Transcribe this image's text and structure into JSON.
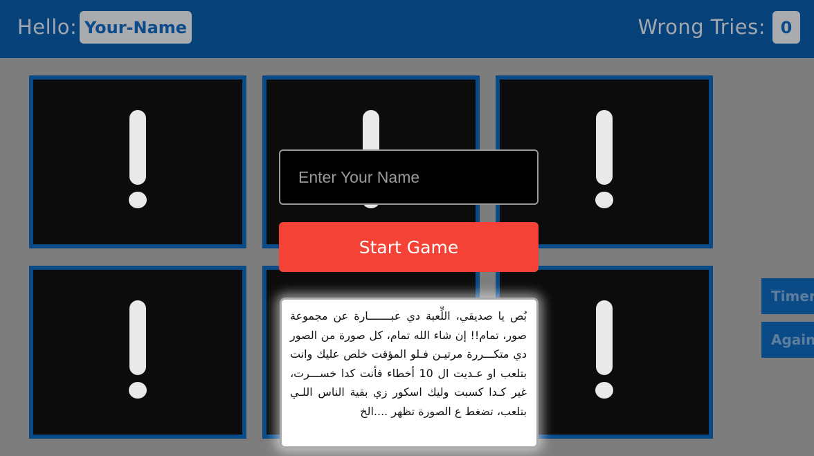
{
  "header": {
    "hello_label": "Hello:",
    "player_name": "Your-Name",
    "wrong_tries_label": "Wrong Tries:",
    "wrong_tries_count": "0",
    "background_color": "#08427a"
  },
  "cards": [
    {
      "face": "!",
      "state": "hidden"
    },
    {
      "face": "!",
      "state": "hidden"
    },
    {
      "face": "!",
      "state": "hidden"
    },
    {
      "face": "!",
      "state": "hidden"
    },
    {
      "face": "!",
      "state": "hidden"
    },
    {
      "face": "!",
      "state": "hidden"
    }
  ],
  "side_buttons": {
    "timer_label": "Timer",
    "again_label": "Again"
  },
  "start_overlay": {
    "name_placeholder": "Enter Your Name",
    "name_value": "",
    "start_button_label": "Start Game",
    "start_button_color": "#f44336",
    "rules_text": "بُص يا صديقي، اللِّعبة دي عبـــــــارة عن مجموعة صور، تمام!! إن شاء الله تمام، كل صورة من الصور دي متكـــررة مرتيـن فـلو المؤقت خلص عليك وانت بتلعب او عـديت ال 10 أخطاء فأنت كدا خســـرت، غير كـدا كسبت وليك اسكور زي بقية الناس اللـي بتلعب، تضغط ع الصورة تظهر ....الخ"
  }
}
